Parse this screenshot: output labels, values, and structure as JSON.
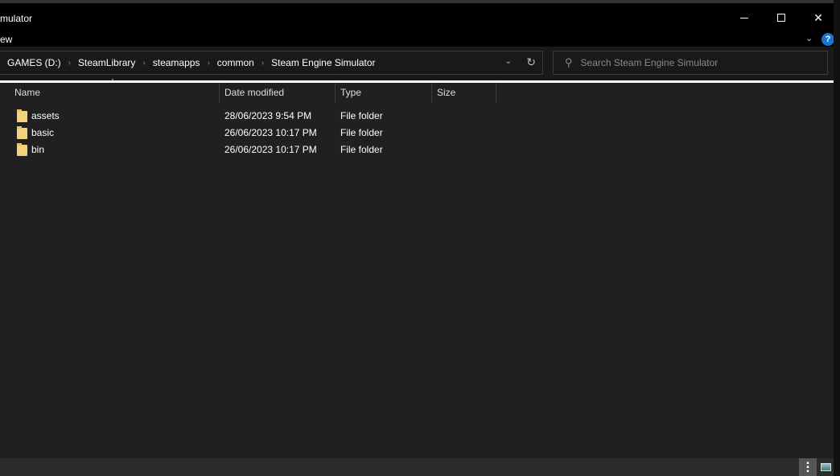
{
  "window": {
    "title": "mulator",
    "menu": "ew"
  },
  "address": {
    "crumbs": [
      "GAMES (D:)",
      "SteamLibrary",
      "steamapps",
      "common",
      "Steam Engine Simulator"
    ]
  },
  "search": {
    "placeholder": "Search Steam Engine Simulator"
  },
  "columns": {
    "name": "Name",
    "date": "Date modified",
    "type": "Type",
    "size": "Size"
  },
  "files": [
    {
      "name": "assets",
      "date": "28/06/2023 9:54 PM",
      "type": "File folder"
    },
    {
      "name": "basic",
      "date": "26/06/2023 10:17 PM",
      "type": "File folder"
    },
    {
      "name": "bin",
      "date": "26/06/2023 10:17 PM",
      "type": "File folder"
    }
  ],
  "help": "?"
}
